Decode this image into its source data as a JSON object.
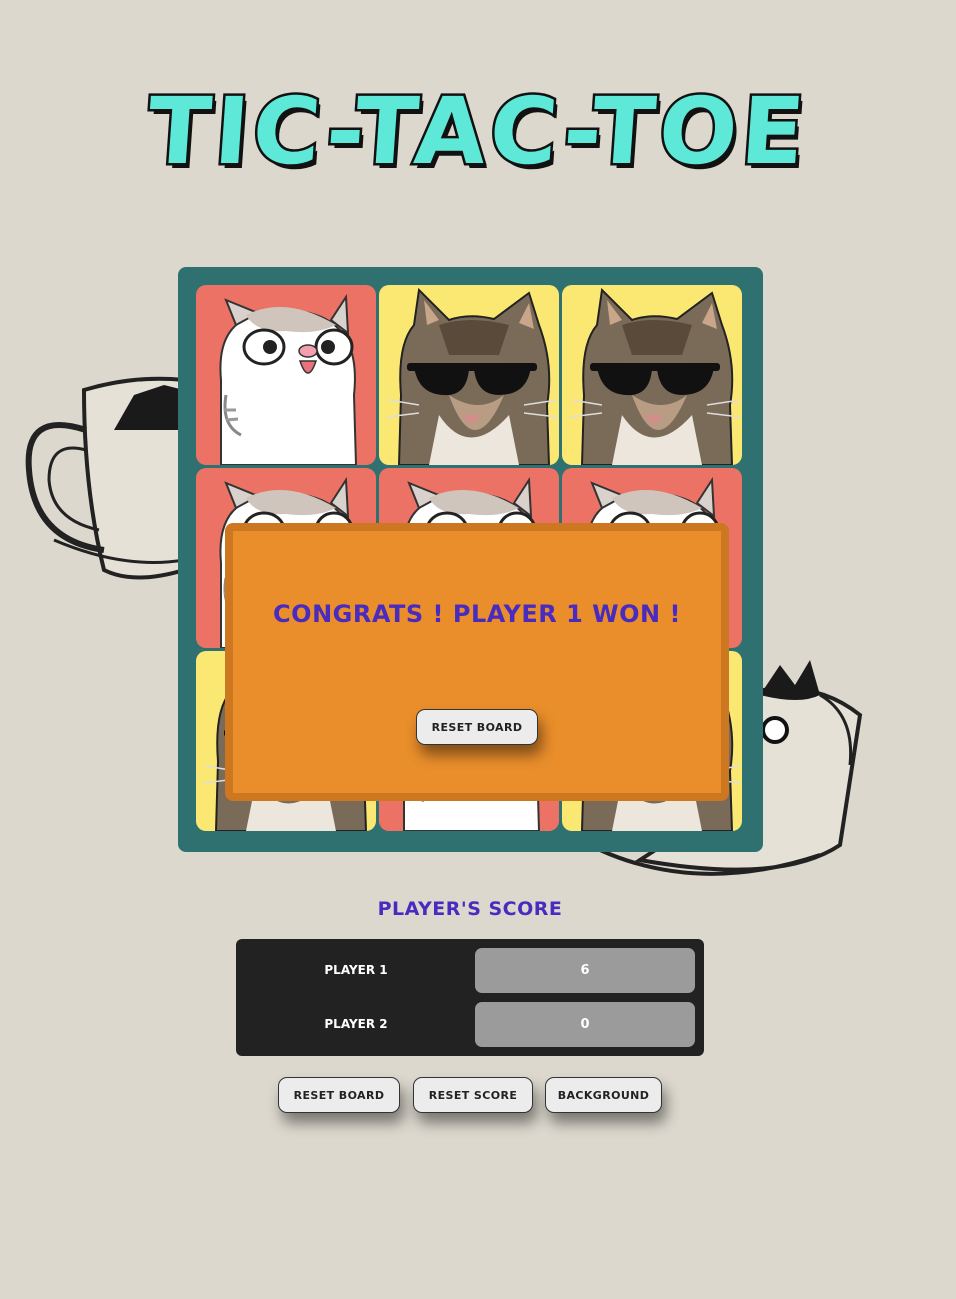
{
  "title": "TIC-TAC-TOE",
  "board": {
    "cells": [
      {
        "player": "player-1",
        "image": "chubby-cat",
        "color": "#ec7265"
      },
      {
        "player": "player-2",
        "image": "sunglasses-cat",
        "color": "#fbe872"
      },
      {
        "player": "player-2",
        "image": "sunglasses-cat",
        "color": "#fbe872"
      },
      {
        "player": "player-1",
        "image": "chubby-cat",
        "color": "#ec7265"
      },
      {
        "player": "player-1",
        "image": "chubby-cat",
        "color": "#ec7265"
      },
      {
        "player": "player-1",
        "image": "chubby-cat",
        "color": "#ec7265"
      },
      {
        "player": "player-2",
        "image": "sunglasses-cat",
        "color": "#fbe872"
      },
      {
        "player": "player-1",
        "image": "chubby-cat",
        "color": "#ec7265"
      },
      {
        "player": "player-2",
        "image": "sunglasses-cat",
        "color": "#fbe872"
      }
    ]
  },
  "modal": {
    "message": "CONGRATS ! PLAYER 1 WON !",
    "button_label": "RESET BOARD"
  },
  "scoreboard": {
    "title": "PLAYER'S SCORE",
    "players": [
      {
        "name": "PLAYER 1",
        "score": "6"
      },
      {
        "name": "PLAYER 2",
        "score": "0"
      }
    ]
  },
  "controls": {
    "reset_board": "RESET BOARD",
    "reset_score": "RESET SCORE",
    "background": "BACKGROUND"
  },
  "colors": {
    "background": "#dcd8ce",
    "title": "#5ee8d8",
    "board_frame": "#2f7071",
    "modal": "#ea8e2b",
    "accent_text": "#4a2bbf",
    "score_panel": "#222222"
  }
}
